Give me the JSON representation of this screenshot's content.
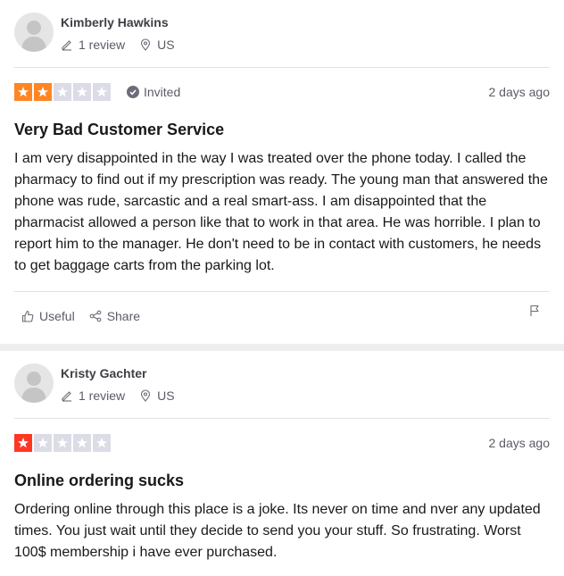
{
  "reviews": [
    {
      "reviewer_name": "Kimberly Hawkins",
      "review_count": "1 review",
      "country": "US",
      "rating": 2,
      "star_color": "#ff8622",
      "verification": "Invited",
      "date": "2 days ago",
      "title": "Very Bad Customer Service",
      "body": "I am very disappointed in the way I was treated over the phone today. I called the pharmacy to find out if my prescription was ready. The young man that answered the phone was rude, sarcastic and a real smart-ass. I am disappointed that the pharmacist allowed a person like that to work in that area. He was horrible. I plan to report him to the manager. He don't need to be in contact with customers, he needs to get baggage carts from the parking lot.",
      "useful_label": "Useful",
      "share_label": "Share"
    },
    {
      "reviewer_name": "Kristy Gachter",
      "review_count": "1 review",
      "country": "US",
      "rating": 1,
      "star_color": "#ff3722",
      "date": "2 days ago",
      "title": "Online ordering sucks",
      "body": "Ordering online through this place is a joke. Its never on time and nver any updated times. You just wait until they decide to send you your stuff. So frustrating. Worst 100$ membership i have ever purchased."
    }
  ],
  "colors": {
    "empty_star": "#dcdce6",
    "separator": "#eeeeee"
  },
  "icons": {
    "avatar": "person-silhouette-icon",
    "review_count": "pencil-icon",
    "location": "map-pin-icon",
    "verified": "check-circle-icon",
    "useful": "thumbs-up-icon",
    "share": "share-icon",
    "report": "flag-icon"
  }
}
